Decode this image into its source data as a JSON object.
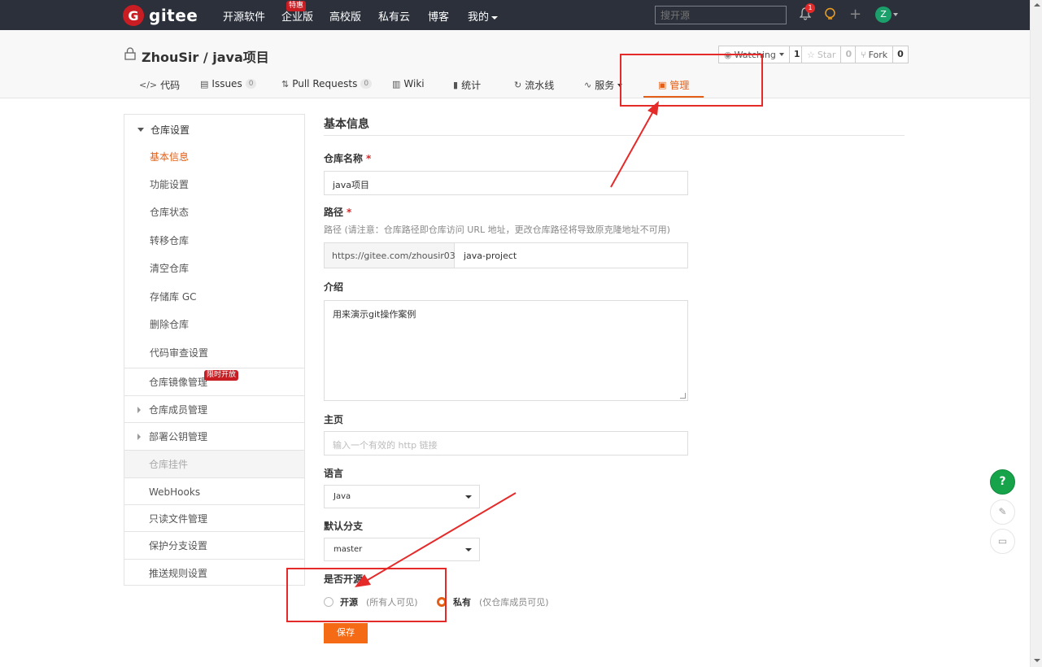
{
  "topnav": {
    "logo_letter": "G",
    "logo_text": "gitee",
    "items": [
      "开源软件",
      "企业版",
      "高校版",
      "私有云",
      "博客",
      "我的"
    ],
    "enterprise_badge": "特惠",
    "search_placeholder": "搜开源",
    "notification_count": "1",
    "avatar_letter": "Z"
  },
  "repo": {
    "title": "ZhouSir / java项目",
    "watching_label": "Watching",
    "watching_count": "1",
    "star_label": "Star",
    "star_count": "0",
    "fork_label": "Fork",
    "fork_count": "0",
    "tabs": [
      {
        "icon": "</>",
        "label": "代码"
      },
      {
        "icon": "▤",
        "label": "Issues",
        "count": "0"
      },
      {
        "icon": "⇅",
        "label": "Pull Requests",
        "count": "0"
      },
      {
        "icon": "▥",
        "label": "Wiki"
      },
      {
        "icon": "▮",
        "label": "统计"
      },
      {
        "icon": "↻",
        "label": "流水线"
      },
      {
        "icon": "∿",
        "label": "服务"
      },
      {
        "icon": "▣",
        "label": "管理"
      }
    ]
  },
  "sidebar": {
    "group_title": "仓库设置",
    "sub_items": [
      "基本信息",
      "功能设置",
      "仓库状态",
      "转移仓库",
      "清空仓库",
      "存储库 GC",
      "删除仓库",
      "代码审查设置"
    ],
    "mirror_label": "仓库镜像管理",
    "mirror_badge": "限时开放",
    "members_label": "仓库成员管理",
    "deploy_keys_label": "部署公钥管理",
    "plugins_label": "仓库挂件",
    "webhooks_label": "WebHooks",
    "readonly_label": "只读文件管理",
    "protected_branch_label": "保护分支设置",
    "push_rules_label": "推送规则设置"
  },
  "form": {
    "section_title": "基本信息",
    "name_label": "仓库名称",
    "name_value": "java项目",
    "path_label": "路径",
    "path_hint": "路径 (请注意：仓库路径即仓库访问 URL 地址，更改仓库路径将导致原克隆地址不可用)",
    "path_prefix": "https://gitee.com/zhousir03/",
    "path_value": "java-project",
    "intro_label": "介绍",
    "intro_value": "用来演示git操作案例",
    "homepage_label": "主页",
    "homepage_placeholder": "输入一个有效的 http 链接",
    "language_label": "语言",
    "language_value": "Java",
    "branch_label": "默认分支",
    "branch_value": "master",
    "open_source_label": "是否开源",
    "option_public": "开源",
    "option_public_desc": "(所有人可见)",
    "option_private": "私有",
    "option_private_desc": "(仅仓库成员可见)",
    "selected_visibility": "私有",
    "save_label": "保存",
    "required_mark": "*"
  },
  "float": {
    "help": "?",
    "edit": "✎",
    "chat": "▭"
  },
  "colors": {
    "accent": "#e35e16",
    "brand_red": "#c71d23",
    "annotation_red": "#e52a2a"
  }
}
